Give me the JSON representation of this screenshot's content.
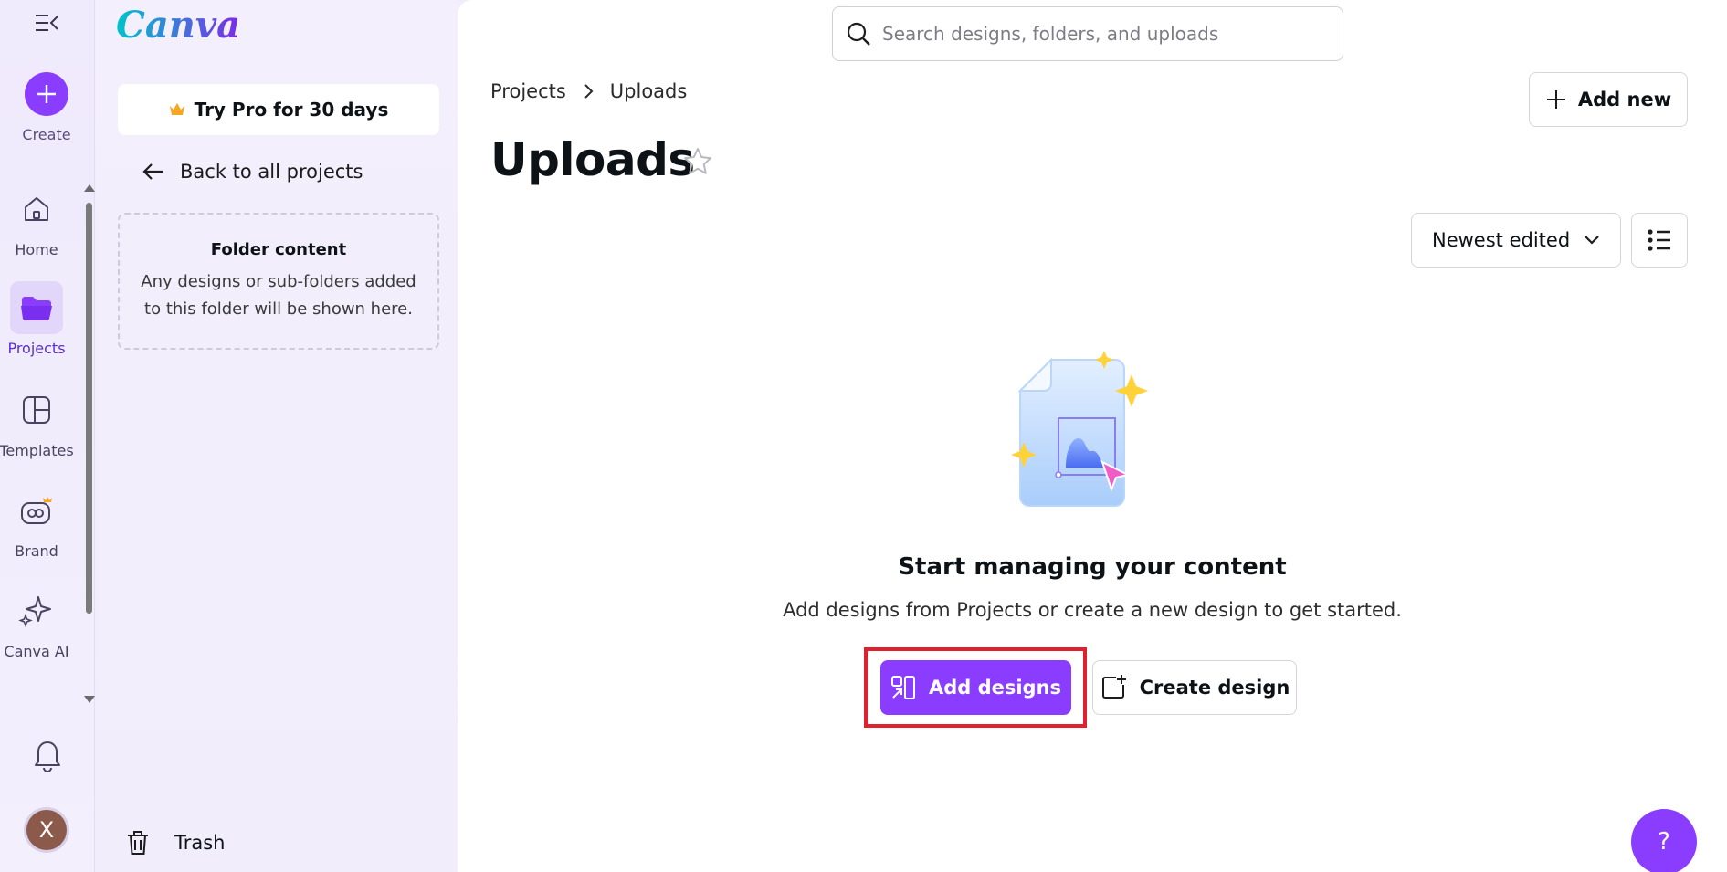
{
  "rail": {
    "create_label": "Create",
    "items": [
      {
        "label": "Home",
        "icon": "home-icon"
      },
      {
        "label": "Projects",
        "icon": "folder-icon"
      },
      {
        "label": "Templates",
        "icon": "templates-icon"
      },
      {
        "label": "Brand",
        "icon": "brand-icon"
      },
      {
        "label": "Canva AI",
        "icon": "sparkle-icon"
      }
    ],
    "avatar_initial": "X"
  },
  "panel": {
    "logo": "Canva",
    "pro_label": "Try Pro for 30 days",
    "back_label": "Back to all projects",
    "folder_title": "Folder content",
    "folder_text": "Any designs or sub-folders added to this folder will be shown here.",
    "trash_label": "Trash"
  },
  "main": {
    "search_placeholder": "Search designs, folders, and uploads",
    "breadcrumb": [
      "Projects",
      "Uploads"
    ],
    "add_new_label": "Add new",
    "title": "Uploads",
    "sort_label": "Newest edited",
    "empty_title": "Start managing your content",
    "empty_sub": "Add designs from Projects or create a new design to get started.",
    "add_designs_label": "Add designs",
    "create_design_label": "Create design",
    "help_label": "?"
  },
  "colors": {
    "accent": "#8b3dff",
    "highlight": "#e0202e"
  }
}
